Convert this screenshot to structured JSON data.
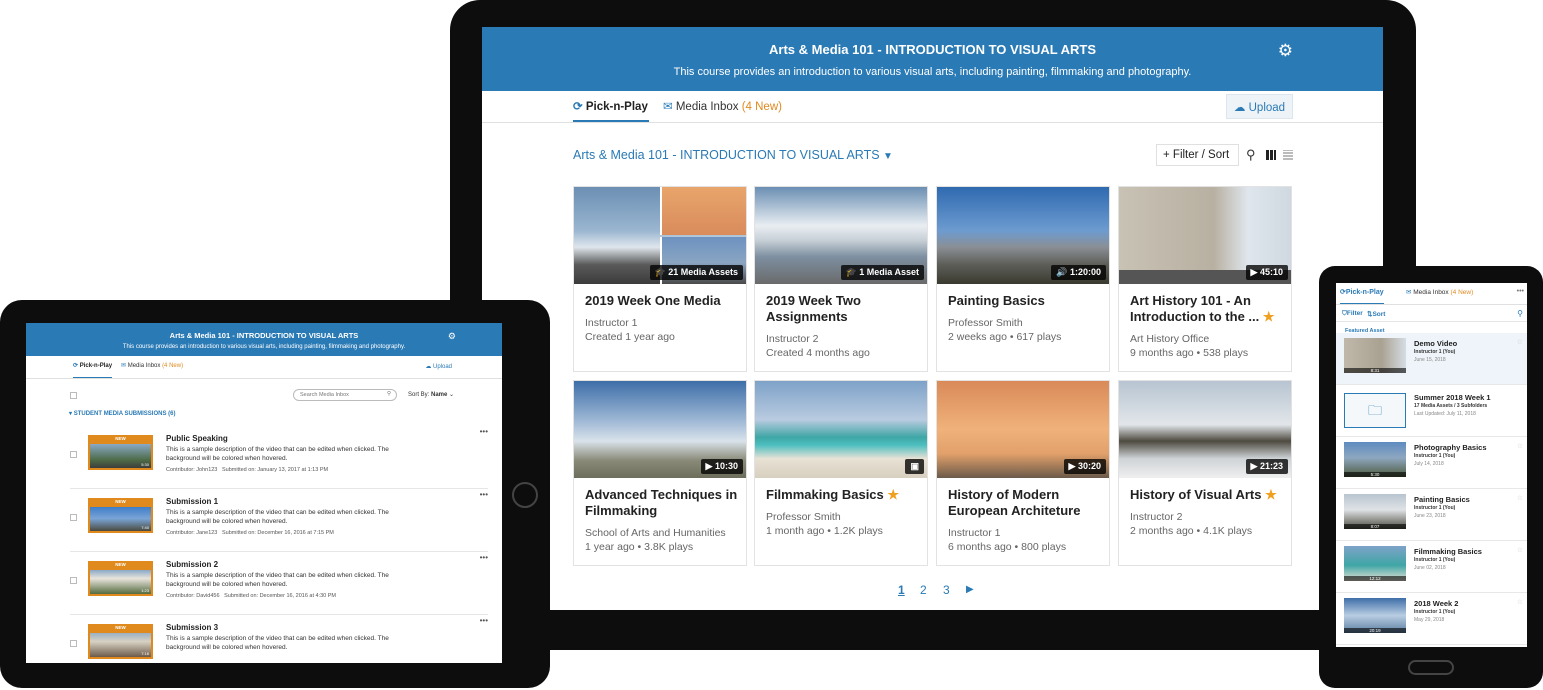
{
  "laptop": {
    "title": "Arts & Media 101 - INTRODUCTION TO VISUAL ARTS",
    "description": "This course provides an introduction to various visual arts, including painting, filmmaking and photography.",
    "tabs": [
      {
        "label": "Pick-n-Play"
      },
      {
        "label": "Media Inbox",
        "extra": "(4 New)"
      }
    ],
    "upload_label": "Upload",
    "course_dropdown": "Arts & Media 101 - INTRODUCTION TO VISUAL ARTS",
    "filter_label": "Filter / Sort",
    "cards": [
      {
        "title": "2019 Week One Media",
        "line1": "Instructor 1",
        "line2": "Created 1 year ago",
        "badge": "21 Media Assets"
      },
      {
        "title": "2019 Week Two Assignments",
        "line1": "Instructor 2",
        "line2": "Created 4 months ago",
        "badge": "1 Media Asset"
      },
      {
        "title": "Painting Basics",
        "line1": "Professor Smith",
        "line2": "2 weeks ago  •  617 plays",
        "badge": "1:20:00"
      },
      {
        "title": "Art History 101 - An Introduction to the ...",
        "line1": "Art History Office",
        "line2": "9 months ago  •  538 plays",
        "badge": "45:10"
      },
      {
        "title": "Advanced Techniques in Filmmaking",
        "line1": "School of Arts and Humanities",
        "line2": "1 year ago  •  3.8K plays",
        "badge": "10:30"
      },
      {
        "title": "Filmmaking Basics",
        "line1": "Professor Smith",
        "line2": "1 month ago  •  1.2K plays",
        "badge": ""
      },
      {
        "title": "History of Modern European Architeture",
        "line1": "Instructor 1",
        "line2": "6 months ago  •  800 plays",
        "badge": "30:20"
      },
      {
        "title": "History of Visual Arts",
        "line1": "Instructor 2",
        "line2": "2 months ago  •  4.1K plays",
        "badge": "21:23"
      }
    ],
    "pages": [
      "1",
      "2",
      "3"
    ]
  },
  "tablet": {
    "title": "Arts & Media 101 - INTRODUCTION TO VISUAL ARTS",
    "description": "This course provides an introduction to various visual arts, including painting, filmmaking and photography.",
    "tabs": [
      {
        "label": "Pick-n-Play"
      },
      {
        "label": "Media Inbox",
        "extra": "(4 New)"
      }
    ],
    "upload_label": "Upload",
    "search_placeholder": "Search Media Inbox",
    "sort_label": "Sort By:",
    "sort_value": "Name",
    "section": "STUDENT MEDIA SUBMISSIONS (6)",
    "items": [
      {
        "title": "Public Speaking",
        "desc": "This is a sample description of the video that can be edited when clicked. The background will be colored when hovered.",
        "contrib": "Contributor: John123",
        "date": "Submitted on: January 13, 2017 at 1:13 PM",
        "time": "5:30",
        "new": "NEW"
      },
      {
        "title": "Submission 1",
        "desc": "This is a sample description of the video that can be edited when clicked. The background will be colored when hovered.",
        "contrib": "Contributor: Jane123",
        "date": "Submitted on: December 16, 2016 at 7:15 PM",
        "time": "7:40",
        "new": "NEW"
      },
      {
        "title": "Submission 2",
        "desc": "This is a sample description of the video that can be edited when clicked. The background will be colored when hovered.",
        "contrib": "Contributor: David456",
        "date": "Submitted on: December 16, 2016 at 4:30 PM",
        "time": "1:23",
        "new": "NEW"
      },
      {
        "title": "Submission 3",
        "desc": "This is a sample description of the video that can be edited when clicked. The background will be colored when hovered.",
        "contrib": "",
        "date": "",
        "time": "7:16",
        "new": "NEW"
      }
    ]
  },
  "phone": {
    "tabs": [
      {
        "label": "Pick-n-Play"
      },
      {
        "label": "Media Inbox",
        "extra": "(4 New)"
      }
    ],
    "filter_label": "Filter",
    "sort_label": "Sort",
    "featured_label": "Featured Asset",
    "items": [
      {
        "title": "Demo Video",
        "sub": "Instructor 1 (You)",
        "date": "June 15, 2018",
        "time": "8:31"
      },
      {
        "title": "Summer 2018 Week 1",
        "sub": "17 Media Assets / 3 Subfolders",
        "date": "Last Updated: July 11, 2018",
        "time": ""
      },
      {
        "title": "Photography Basics",
        "sub": "Instructor 1 (You)",
        "date": "July 14, 2018",
        "time": "5:30"
      },
      {
        "title": "Painting Basics",
        "sub": "Instructor 1 (You)",
        "date": "June 23, 2018",
        "time": "8:07"
      },
      {
        "title": "Filmmaking Basics",
        "sub": "Instructor 1 (You)",
        "date": "June 02, 2018",
        "time": "12:12"
      },
      {
        "title": "2018 Week 2",
        "sub": "Instructor 1 (You)",
        "date": "May 29, 2018",
        "time": "20:19"
      }
    ]
  },
  "colors": {
    "brand": "#2a7ab5",
    "accent": "#e08a1e",
    "star": "#f0a020"
  }
}
